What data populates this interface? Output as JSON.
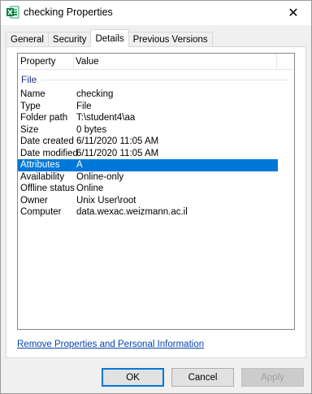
{
  "window": {
    "title": "checking Properties",
    "close_glyph": "✕",
    "app_icon": "excel-icon",
    "accent_color": "#0078d7"
  },
  "tabs": [
    {
      "label": "General",
      "active": false
    },
    {
      "label": "Security",
      "active": false
    },
    {
      "label": "Details",
      "active": true
    },
    {
      "label": "Previous Versions",
      "active": false
    }
  ],
  "details": {
    "columns": {
      "property": "Property",
      "value": "Value"
    },
    "group": "File",
    "rows": [
      {
        "property": "Name",
        "value": "checking"
      },
      {
        "property": "Type",
        "value": "File"
      },
      {
        "property": "Folder path",
        "value": "T:\\student4\\aa"
      },
      {
        "property": "Size",
        "value": "0 bytes"
      },
      {
        "property": "Date created",
        "value": "6/11/2020 11:05 AM"
      },
      {
        "property": "Date modified",
        "value": "6/11/2020 11:05 AM"
      },
      {
        "property": "Attributes",
        "value": "A"
      },
      {
        "property": "Availability",
        "value": "Online-only"
      },
      {
        "property": "Offline status",
        "value": "Online"
      },
      {
        "property": "Owner",
        "value": "Unix User\\root"
      },
      {
        "property": "Computer",
        "value": "data.wexac.weizmann.ac.il"
      }
    ],
    "selected_row": "Attributes"
  },
  "link": {
    "label": "Remove Properties and Personal Information"
  },
  "buttons": {
    "ok": "OK",
    "cancel": "Cancel",
    "apply": "Apply"
  }
}
